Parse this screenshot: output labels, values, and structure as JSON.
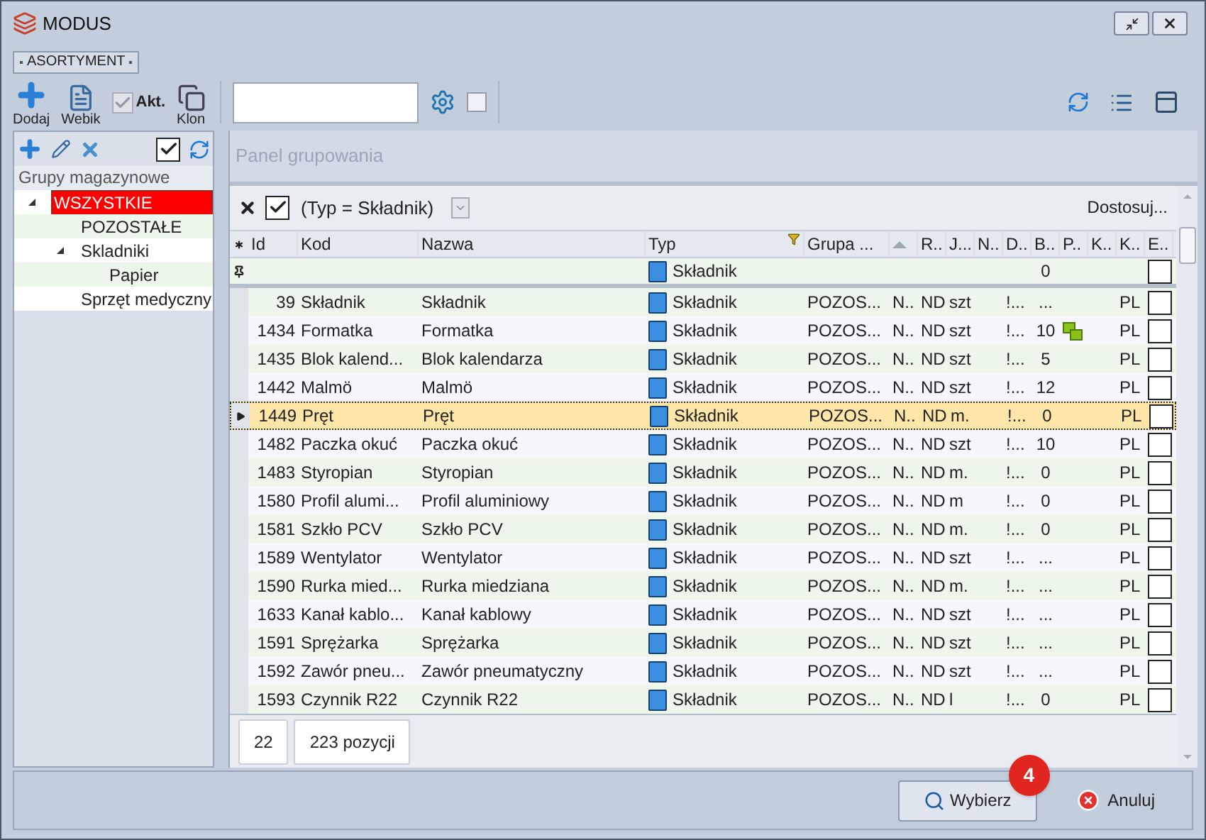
{
  "window": {
    "title": "MODUS"
  },
  "tab": {
    "label": "ASORTYMENT"
  },
  "toolbar": {
    "buttons": [
      {
        "kind": "add",
        "label": "Dodaj"
      },
      {
        "kind": "doc",
        "label": "Webik"
      },
      {
        "kind": "check",
        "label": "Akt.",
        "checked": true,
        "disabled": true
      },
      {
        "kind": "copy",
        "label": "Klon"
      }
    ],
    "search_option": {
      "checked": false
    }
  },
  "left_panel": {
    "show_all": {
      "checked": true
    },
    "header": "Grupy magazynowe",
    "tree": [
      {
        "label": "WSZYSTKIE",
        "selected": true,
        "expanded": true,
        "children": [
          {
            "label": "POZOSTAŁE",
            "selected": false
          },
          {
            "label": "Skladniki",
            "selected": false,
            "expanded": true,
            "children": [
              {
                "label": "Papier",
                "selected": false
              }
            ]
          },
          {
            "label": "Sprzęt medyczny",
            "selected": false
          }
        ]
      }
    ]
  },
  "grid": {
    "group_panel": "Panel grupowania",
    "filter": {
      "text": "(Typ = Składnik)",
      "enabled": true
    },
    "customize": "Dostosuj...",
    "columns": [
      {
        "label": "Id",
        "filtered": false,
        "sorted": false
      },
      {
        "label": "Kod",
        "filtered": false,
        "sorted": false
      },
      {
        "label": "Nazwa",
        "filtered": false,
        "sorted": false
      },
      {
        "label": "Typ",
        "filtered": true,
        "sorted": false
      },
      {
        "label": "Grupa ...",
        "filtered": false,
        "sorted": false
      },
      {
        "filtered": false,
        "sorted": true
      },
      {
        "label": "R..",
        "filtered": false,
        "sorted": false
      },
      {
        "label": "J...",
        "filtered": false,
        "sorted": false
      },
      {
        "label": "N..",
        "filtered": false,
        "sorted": false
      },
      {
        "label": "D..",
        "filtered": false,
        "sorted": false
      },
      {
        "label": "B..",
        "filtered": false,
        "sorted": false
      },
      {
        "label": "P..",
        "filtered": false,
        "sorted": false
      },
      {
        "label": "K..",
        "filtered": false,
        "sorted": false
      },
      {
        "label": "K..",
        "filtered": false,
        "sorted": false
      },
      {
        "label": "E..",
        "filtered": false,
        "sorted": false
      }
    ],
    "filter_row": {
      "typ": "Składnik",
      "b": "0",
      "e": false
    },
    "rows": [
      {
        "id": "39",
        "kod": "Składnik",
        "nazwa": "Składnik",
        "typ": "Składnik",
        "grupa": "POZOS...",
        "column_6": "N..",
        "r": "ND",
        "j": "szt",
        "d": "!...",
        "b": "...",
        "p_icon": false,
        "k2": "PL",
        "e": false,
        "selected": false
      },
      {
        "id": "1434",
        "kod": "Formatka",
        "nazwa": "Formatka",
        "typ": "Składnik",
        "grupa": "POZOS...",
        "column_6": "N..",
        "r": "ND",
        "j": "szt",
        "d": "!...",
        "b": "10",
        "p_icon": true,
        "k2": "PL",
        "e": false,
        "selected": false
      },
      {
        "id": "1435",
        "kod": "Blok kalend...",
        "nazwa": "Blok kalendarza",
        "typ": "Składnik",
        "grupa": "POZOS...",
        "column_6": "N..",
        "r": "ND",
        "j": "szt",
        "d": "!...",
        "b": "5",
        "p_icon": false,
        "k2": "PL",
        "e": false,
        "selected": false
      },
      {
        "id": "1442",
        "kod": "Malmö",
        "nazwa": "Malmö",
        "typ": "Składnik",
        "grupa": "POZOS...",
        "column_6": "N..",
        "r": "ND",
        "j": "szt",
        "d": "!...",
        "b": "12",
        "p_icon": false,
        "k2": "PL",
        "e": false,
        "selected": false
      },
      {
        "id": "1449",
        "kod": "Pręt",
        "nazwa": "Pręt",
        "typ": "Składnik",
        "grupa": "POZOS...",
        "column_6": "N..",
        "r": "ND",
        "j": "m.",
        "d": "!...",
        "b": "0",
        "p_icon": false,
        "k2": "PL",
        "e": false,
        "selected": true
      },
      {
        "id": "1482",
        "kod": "Paczka okuć",
        "nazwa": "Paczka okuć",
        "typ": "Składnik",
        "grupa": "POZOS...",
        "column_6": "N..",
        "r": "ND",
        "j": "szt",
        "d": "!...",
        "b": "10",
        "p_icon": false,
        "k2": "PL",
        "e": false,
        "selected": false
      },
      {
        "id": "1483",
        "kod": "Styropian",
        "nazwa": "Styropian",
        "typ": "Składnik",
        "grupa": "POZOS...",
        "column_6": "N..",
        "r": "ND",
        "j": "m.",
        "d": "!...",
        "b": "0",
        "p_icon": false,
        "k2": "PL",
        "e": false,
        "selected": false
      },
      {
        "id": "1580",
        "kod": "Profil alumi...",
        "nazwa": "Profil aluminiowy",
        "typ": "Składnik",
        "grupa": "POZOS...",
        "column_6": "N..",
        "r": "ND",
        "j": "m",
        "d": "!...",
        "b": "0",
        "p_icon": false,
        "k2": "PL",
        "e": false,
        "selected": false
      },
      {
        "id": "1581",
        "kod": "Szkło PCV",
        "nazwa": "Szkło PCV",
        "typ": "Składnik",
        "grupa": "POZOS...",
        "column_6": "N..",
        "r": "ND",
        "j": "m.",
        "d": "!...",
        "b": "0",
        "p_icon": false,
        "k2": "PL",
        "e": false,
        "selected": false
      },
      {
        "id": "1589",
        "kod": "Wentylator",
        "nazwa": "Wentylator",
        "typ": "Składnik",
        "grupa": "POZOS...",
        "column_6": "N..",
        "r": "ND",
        "j": "szt",
        "d": "!...",
        "b": "...",
        "p_icon": false,
        "k2": "PL",
        "e": false,
        "selected": false
      },
      {
        "id": "1590",
        "kod": "Rurka mied...",
        "nazwa": "Rurka miedziana",
        "typ": "Składnik",
        "grupa": "POZOS...",
        "column_6": "N..",
        "r": "ND",
        "j": "m.",
        "d": "!...",
        "b": "...",
        "p_icon": false,
        "k2": "PL",
        "e": false,
        "selected": false
      },
      {
        "id": "1633",
        "kod": "Kanał kablo...",
        "nazwa": "Kanał kablowy",
        "typ": "Składnik",
        "grupa": "POZOS...",
        "column_6": "N..",
        "r": "ND",
        "j": "szt",
        "d": "!...",
        "b": "...",
        "p_icon": false,
        "k2": "PL",
        "e": false,
        "selected": false
      },
      {
        "id": "1591",
        "kod": "Sprężarka",
        "nazwa": "Sprężarka",
        "typ": "Składnik",
        "grupa": "POZOS...",
        "column_6": "N..",
        "r": "ND",
        "j": "szt",
        "d": "!...",
        "b": "...",
        "p_icon": false,
        "k2": "PL",
        "e": false,
        "selected": false
      },
      {
        "id": "1592",
        "kod": "Zawór pneu...",
        "nazwa": "Zawór pneumatyczny",
        "typ": "Składnik",
        "grupa": "POZOS...",
        "column_6": "N..",
        "r": "ND",
        "j": "szt",
        "d": "!...",
        "b": "...",
        "p_icon": false,
        "k2": "PL",
        "e": false,
        "selected": false
      },
      {
        "id": "1593",
        "kod": "Czynnik R22",
        "nazwa": "Czynnik R22",
        "typ": "Składnik",
        "grupa": "POZOS...",
        "column_6": "N..",
        "r": "ND",
        "j": "l",
        "d": "!...",
        "b": "0",
        "p_icon": false,
        "k2": "PL",
        "e": false,
        "selected": false
      }
    ],
    "footer": {
      "count": "22",
      "total": "223 pozycji"
    }
  },
  "buttons": [
    {
      "kind": "select",
      "label": "Wybierz",
      "badge": "4"
    },
    {
      "kind": "cancel",
      "label": "Anuluj"
    }
  ]
}
